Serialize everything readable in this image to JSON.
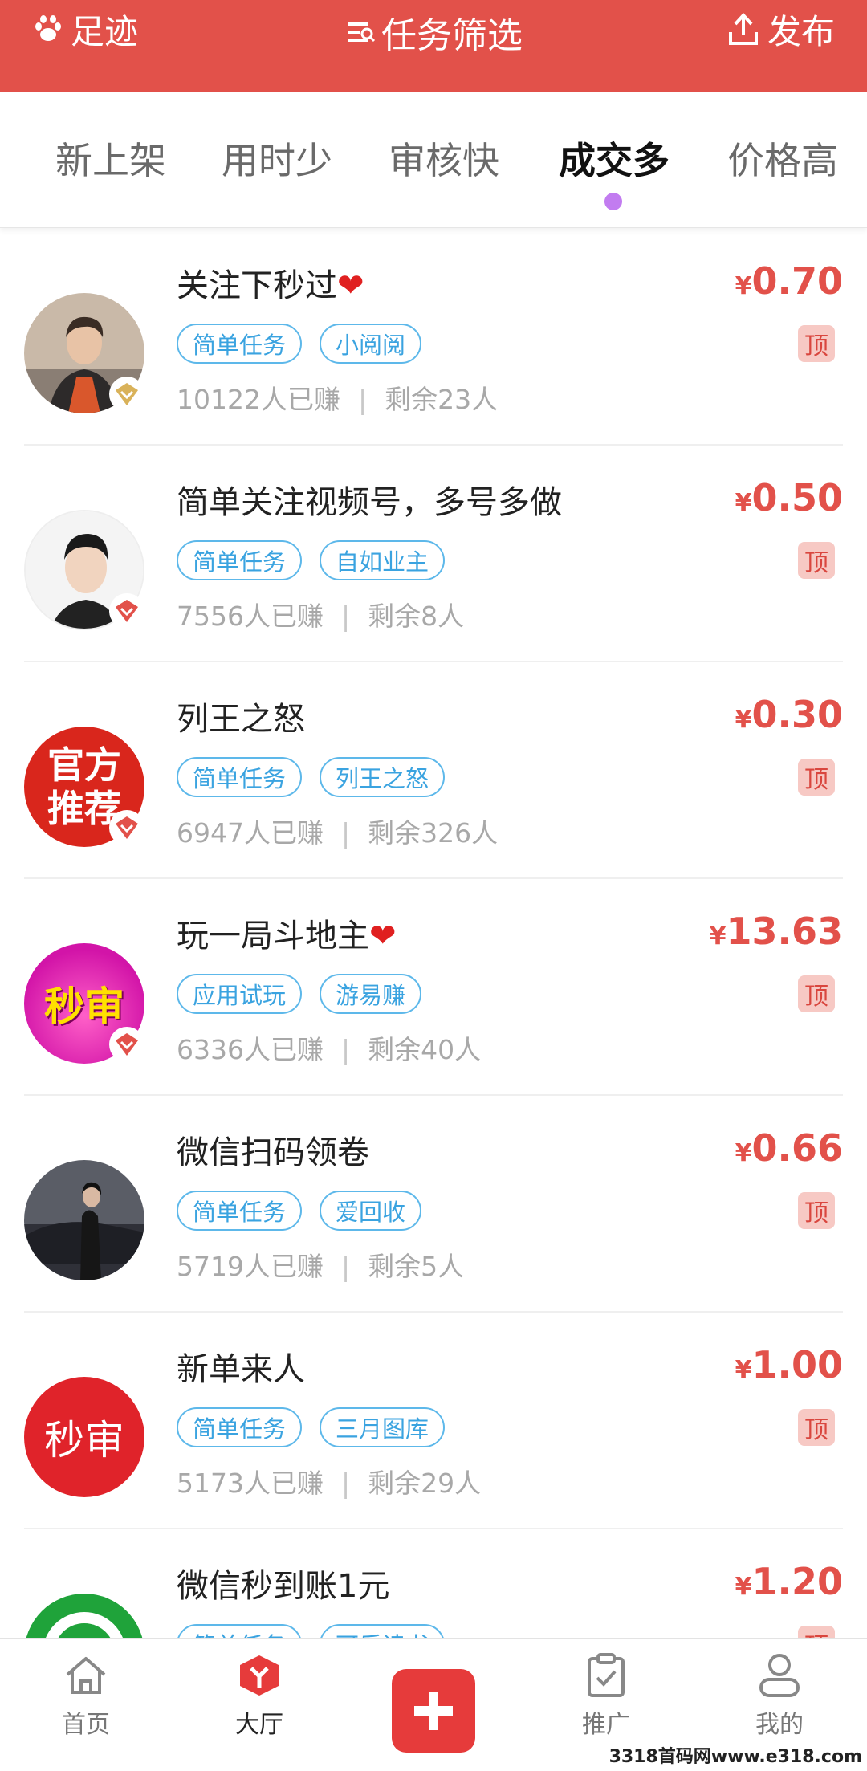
{
  "header": {
    "left_label": "足迹",
    "title": "任务筛选",
    "right_label": "发布"
  },
  "tabs": [
    {
      "label": "新上架",
      "active": false
    },
    {
      "label": "用时少",
      "active": false
    },
    {
      "label": "审核快",
      "active": false
    },
    {
      "label": "成交多",
      "active": true
    },
    {
      "label": "价格高",
      "active": false
    }
  ],
  "tasks": [
    {
      "title": "关注下秒过",
      "heart": "❤",
      "tags": [
        "简单任务",
        "小阅阅"
      ],
      "earned": "10122人已赚",
      "remaining": "剩余23人",
      "currency": "¥",
      "price": "0.70",
      "pin": "顶",
      "avatar": "photo-man-jacket"
    },
    {
      "title": "简单关注视频号，多号多做",
      "heart": "",
      "tags": [
        "简单任务",
        "自如业主"
      ],
      "earned": "7556人已赚",
      "remaining": "剩余8人",
      "currency": "¥",
      "price": "0.50",
      "pin": "顶",
      "avatar": "photo-man-portrait"
    },
    {
      "title": "列王之怒",
      "heart": "",
      "tags": [
        "简单任务",
        "列王之怒"
      ],
      "earned": "6947人已赚",
      "remaining": "剩余326人",
      "currency": "¥",
      "price": "0.30",
      "pin": "顶",
      "avatar": "官方推荐"
    },
    {
      "title": "玩一局斗地主",
      "heart": "❤",
      "tags": [
        "应用试玩",
        "游易赚"
      ],
      "earned": "6336人已赚",
      "remaining": "剩余40人",
      "currency": "¥",
      "price": "13.63",
      "pin": "顶",
      "avatar": "秒审"
    },
    {
      "title": "微信扫码领卷",
      "heart": "",
      "tags": [
        "简单任务",
        "爱回收"
      ],
      "earned": "5719人已赚",
      "remaining": "剩余5人",
      "currency": "¥",
      "price": "0.66",
      "pin": "顶",
      "avatar": "photo-woman-car"
    },
    {
      "title": "新单来人",
      "heart": "",
      "tags": [
        "简单任务",
        "三月图库"
      ],
      "earned": "5173人已赚",
      "remaining": "剩余29人",
      "currency": "¥",
      "price": "1.00",
      "pin": "顶",
      "avatar": "秒审"
    },
    {
      "title": "微信秒到账1元",
      "heart": "",
      "tags": [
        "简单任务",
        "可乐读书"
      ],
      "earned": "",
      "remaining": "",
      "currency": "¥",
      "price": "1.20",
      "pin": "顶",
      "avatar": "green-logo"
    }
  ],
  "avatar_text": {
    "official_line1": "官方",
    "official_line2": "推荐",
    "instant_review": "秒审"
  },
  "bottom_nav": [
    {
      "label": "首页",
      "icon": "home-icon"
    },
    {
      "label": "大厅",
      "icon": "hall-icon",
      "active": true
    },
    {
      "label": "",
      "icon": "plus-icon"
    },
    {
      "label": "推广",
      "icon": "clipboard-icon"
    },
    {
      "label": "我的",
      "icon": "user-icon"
    }
  ],
  "watermark": "3318首码网www.e318.com",
  "colors": {
    "header": "#e2514a",
    "price": "#e2514a",
    "tag": "#3aa3e0",
    "active_dot": "#c27cf0"
  }
}
